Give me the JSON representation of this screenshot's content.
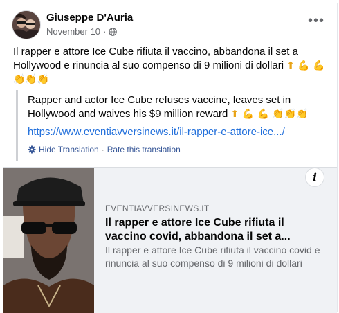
{
  "post": {
    "author": "Giuseppe D'Auria",
    "date": "November 10",
    "date_separator": "·",
    "privacy_icon": "globe-icon",
    "more_options": "•••",
    "text_main": "Il rapper e attore Ice Cube rifiuta il vaccino, abbandona il set a Hollywood e rinuncia al suo compenso di 9 milioni di dollari",
    "text_emojis_line1": "⬆ 💪 💪",
    "text_emojis_line2": "👏👏👏"
  },
  "translation": {
    "text": "Rapper and actor Ice Cube refuses vaccine, leaves set in Hollywood and waives his $9 million reward",
    "emojis": "⬆ 💪 💪 👏👏👏",
    "link": "https://www.eventiavversinews.it/il-rapper-e-attore-ice.../",
    "hide_label": "Hide Translation",
    "separator": "·",
    "rate_label": "Rate this translation"
  },
  "link_preview": {
    "domain": "EVENTIAVVERSINEWS.IT",
    "title": "Il rapper e attore Ice Cube rifiuta il vaccino covid, abbandona il set a...",
    "description": "Il rapper e attore Ice Cube rifiuta il vaccino covid e rinuncia al suo compenso di 9 milioni di dollari",
    "info_label": "i"
  },
  "colors": {
    "link": "#216fdb",
    "secondary_text": "#65676b",
    "preview_bg": "#f0f2f5"
  }
}
